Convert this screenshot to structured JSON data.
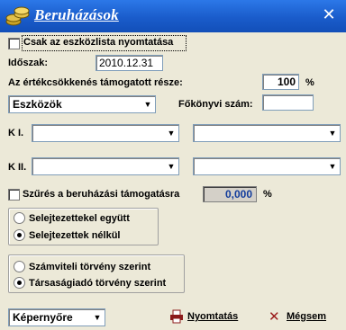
{
  "window": {
    "title": "Beruházások",
    "close_symbol": "✕"
  },
  "export_only_listed": {
    "label": "Csak az eszközlista nyomtatása",
    "checked": false
  },
  "period": {
    "label": "Időszak:",
    "value": "2010.12.31"
  },
  "depreciation_support": {
    "label": "Az értékcsökkenés támogatott része:",
    "value": "100",
    "unit": "%"
  },
  "category_combo": {
    "value": "Eszközök"
  },
  "ledger": {
    "label": "Főkönyvi szám:",
    "value": ""
  },
  "k1": {
    "label": "K I.",
    "combo1_value": "",
    "combo2_value": ""
  },
  "k2": {
    "label": "K II.",
    "combo1_value": "",
    "combo2_value": ""
  },
  "filter": {
    "label": "Szűrés a beruházási támogatásra",
    "checked": false,
    "value": "0,000",
    "unit": "%"
  },
  "scrap_group": {
    "options": [
      {
        "label": "Selejtezettekel együtt",
        "selected": false
      },
      {
        "label": "Selejtezettek nélkül",
        "selected": true
      }
    ]
  },
  "law_group": {
    "options": [
      {
        "label": "Számviteli törvény szerint",
        "selected": false
      },
      {
        "label": "Társaságiadó törvény szerint",
        "selected": true
      }
    ]
  },
  "output_combo": {
    "value": "Képernyőre"
  },
  "print_button": {
    "label": "Nyomtatás"
  },
  "cancel_button": {
    "label": "Mégsem"
  }
}
